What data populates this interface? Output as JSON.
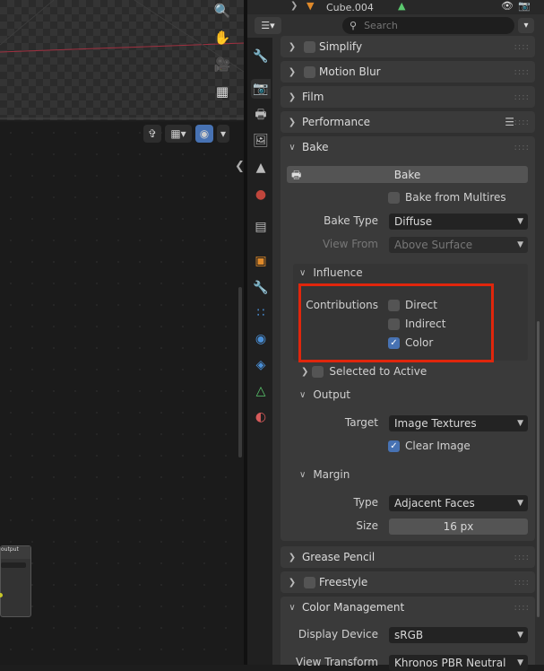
{
  "outliner": {
    "object_name": "Cube.004"
  },
  "properties_header": {
    "search_placeholder": "Search"
  },
  "panels": {
    "simplify": "Simplify",
    "motion_blur": "Motion Blur",
    "film": "Film",
    "performance": "Performance",
    "bake": "Bake",
    "grease_pencil": "Grease Pencil",
    "freestyle": "Freestyle",
    "color_management": "Color Management"
  },
  "bake": {
    "bake_button": "Bake",
    "bake_from_multires": "Bake from Multires",
    "bake_type_label": "Bake Type",
    "bake_type_value": "Diffuse",
    "view_from_label": "View From",
    "view_from_value": "Above Surface",
    "influence": {
      "title": "Influence",
      "contributions_label": "Contributions",
      "direct": "Direct",
      "indirect": "Indirect",
      "color": "Color"
    },
    "selected_to_active": "Selected to Active",
    "output": {
      "title": "Output",
      "target_label": "Target",
      "target_value": "Image Textures",
      "clear_image": "Clear Image"
    },
    "margin": {
      "title": "Margin",
      "type_label": "Type",
      "type_value": "Adjacent Faces",
      "size_label": "Size",
      "size_value": "16 px"
    }
  },
  "color_management": {
    "display_device_label": "Display Device",
    "display_device_value": "sRGB",
    "view_transform_label": "View Transform",
    "view_transform_value": "Khronos PBR Neutral"
  },
  "node_editor": {
    "node_title": "output"
  },
  "colors": {
    "accent": "#4772b3",
    "highlight": "#e0260c"
  }
}
